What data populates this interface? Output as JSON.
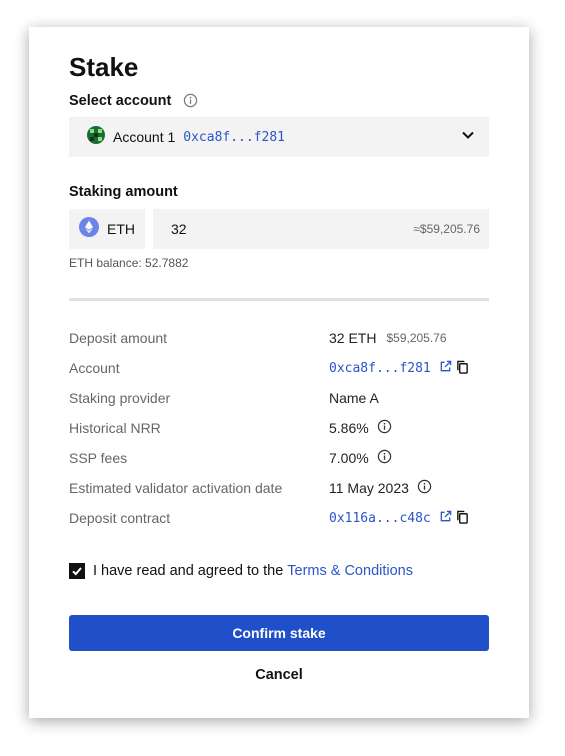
{
  "title": "Stake",
  "select_account": {
    "label": "Select account",
    "account_name": "Account 1",
    "account_address": "0xca8f...f281"
  },
  "staking": {
    "label": "Staking amount",
    "token": "ETH",
    "amount": "32",
    "usd": "≈$59,205.76",
    "balance": "ETH balance: 52.7882"
  },
  "details": {
    "deposit_amount": {
      "label": "Deposit amount",
      "value": "32 ETH",
      "usd": "$59,205.76"
    },
    "account": {
      "label": "Account",
      "value": "0xca8f...f281"
    },
    "provider": {
      "label": "Staking provider",
      "value": "Name A"
    },
    "nrr": {
      "label": "Historical NRR",
      "value": "5.86%"
    },
    "ssp_fees": {
      "label": "SSP fees",
      "value": "7.00%"
    },
    "activation": {
      "label": "Estimated validator activation date",
      "value": "11 May 2023"
    },
    "contract": {
      "label": "Deposit contract",
      "value": "0x116a...c48c"
    }
  },
  "agreement": {
    "text": "I have read and agreed to the",
    "link": "Terms & Conditions",
    "checked": true
  },
  "buttons": {
    "confirm": "Confirm stake",
    "cancel": "Cancel"
  },
  "colors": {
    "accent": "#1f4fc9",
    "link": "#2a55c8",
    "field_bg": "#f3f3f3"
  },
  "icons": [
    "info-icon",
    "account-avatar-icon",
    "chevron-down-icon",
    "eth-icon",
    "external-link-icon",
    "copy-icon",
    "checkmark-icon"
  ]
}
